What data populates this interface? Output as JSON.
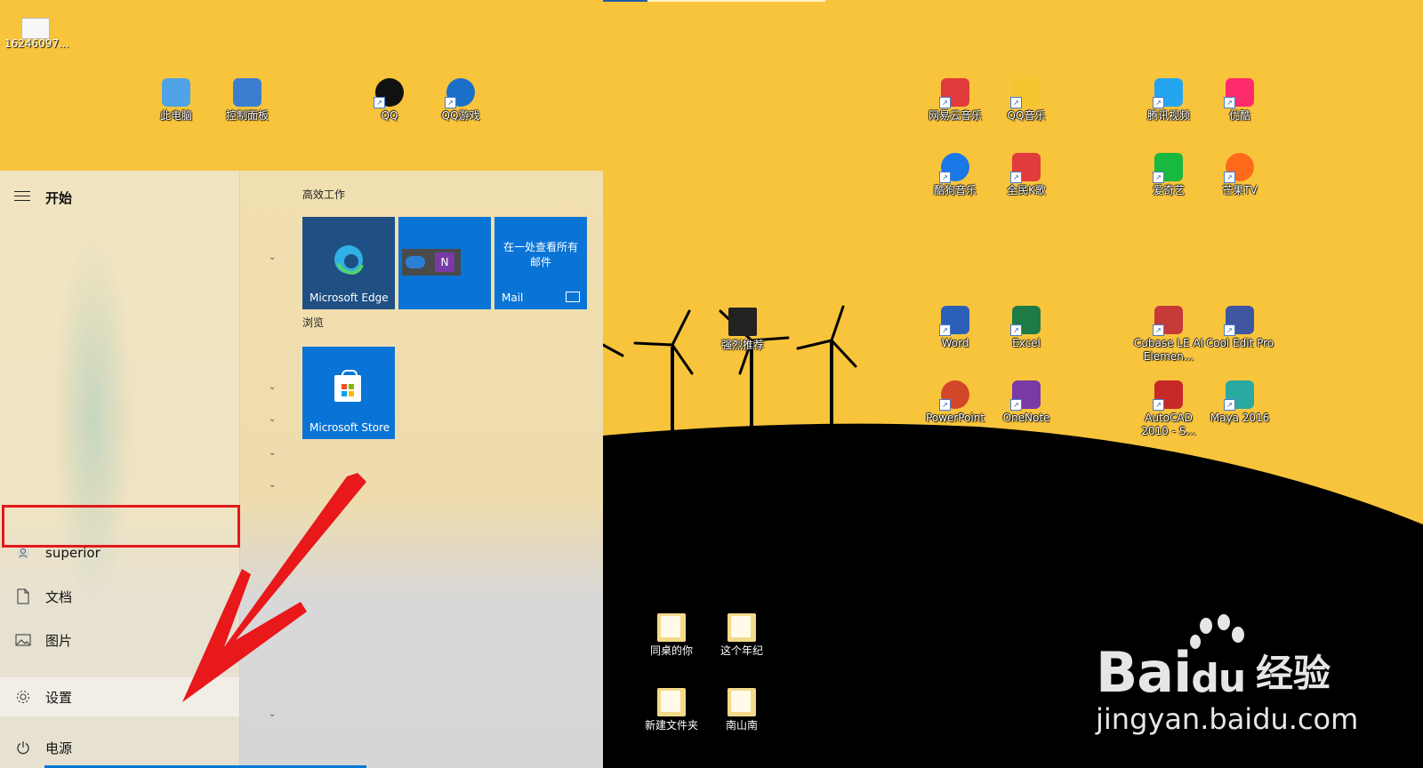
{
  "desktop": {
    "topleft_file": "16246097...",
    "icons": [
      {
        "label": "此电脑",
        "color": "#4fa3e6"
      },
      {
        "label": "控制面板",
        "color": "#3b7ed0"
      },
      {
        "label": "QQ",
        "color": "#111111"
      },
      {
        "label": "QQ游戏",
        "color": "#1a70c9"
      },
      {
        "label": "网易云音乐",
        "color": "#e03a3a"
      },
      {
        "label": "QQ音乐",
        "color": "#f5c431"
      },
      {
        "label": "腾讯视频",
        "color": "#23a5f0"
      },
      {
        "label": "优酷",
        "color": "#ff2a6d"
      },
      {
        "label": "酷狗音乐",
        "color": "#1a78e6"
      },
      {
        "label": "全民K歌",
        "color": "#e23b3b"
      },
      {
        "label": "爱奇艺",
        "color": "#19b83e"
      },
      {
        "label": "芒果TV",
        "color": "#ff6a1a"
      },
      {
        "label": "强烈推荐",
        "color": "#222222"
      },
      {
        "label": "Word",
        "color": "#2b5fb8"
      },
      {
        "label": "Excel",
        "color": "#1e7b45"
      },
      {
        "label": "Cubase LE AI Elemen...",
        "color": "#c63a3a"
      },
      {
        "label": "Cool Edit Pro",
        "color": "#3f55a0"
      },
      {
        "label": "PowerPoint",
        "color": "#d2472a"
      },
      {
        "label": "OneNote",
        "color": "#7a3aa6"
      },
      {
        "label": "AutoCAD 2010 - S...",
        "color": "#c62828"
      },
      {
        "label": "Maya 2016",
        "color": "#2aa9a0"
      },
      {
        "label": "同桌的你",
        "color": "#f3d98a"
      },
      {
        "label": "这个年纪",
        "color": "#f3d98a"
      },
      {
        "label": "新建文件夹",
        "color": "#f3d98a"
      },
      {
        "label": "南山南",
        "color": "#f3d98a"
      }
    ]
  },
  "start_menu": {
    "title": "开始",
    "left_items": [
      {
        "label": "superior",
        "icon": "user-icon"
      },
      {
        "label": "文档",
        "icon": "document-icon"
      },
      {
        "label": "图片",
        "icon": "pictures-icon"
      },
      {
        "label": "设置",
        "icon": "gear-icon"
      },
      {
        "label": "电源",
        "icon": "power-icon"
      }
    ],
    "groups": [
      {
        "label": "高效工作"
      },
      {
        "label": "浏览"
      }
    ],
    "tiles": {
      "edge": "Microsoft Edge",
      "mail_top": "在一处查看所有邮件",
      "mail": "Mail",
      "store": "Microsoft Store"
    }
  },
  "watermark": {
    "brand": "Bai",
    "brand2": "du",
    "cn": "经验",
    "url": "jingyan.baidu.com"
  }
}
